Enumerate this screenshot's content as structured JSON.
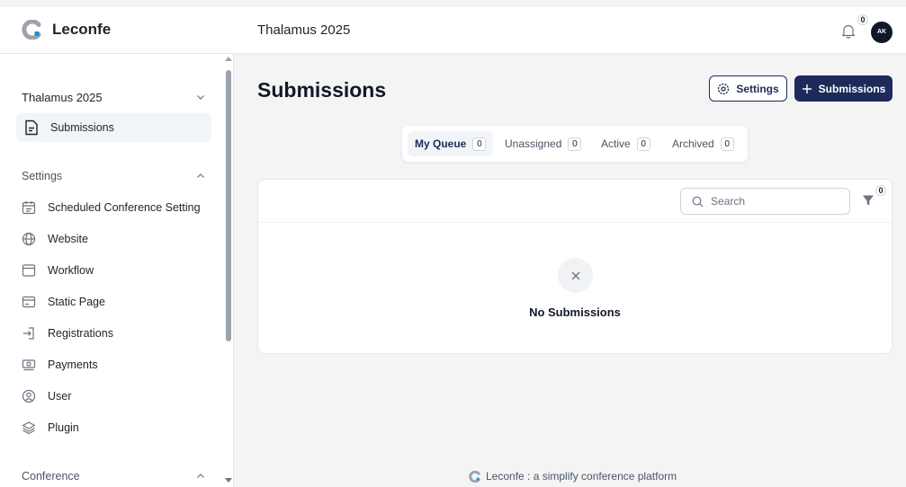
{
  "header": {
    "brand": "Leconfe",
    "conference": "Thalamus 2025",
    "notification_count": "0",
    "avatar_initials": "AK"
  },
  "sidebar": {
    "conference_select": "Thalamus 2025",
    "active_item": {
      "label": "Submissions",
      "icon": "document-icon"
    },
    "settings_group": {
      "label": "Settings",
      "items": [
        {
          "label": "Scheduled Conference Setting",
          "icon": "calendar-icon"
        },
        {
          "label": "Website",
          "icon": "globe-icon"
        },
        {
          "label": "Workflow",
          "icon": "window-icon"
        },
        {
          "label": "Static Page",
          "icon": "page-icon"
        },
        {
          "label": "Registrations",
          "icon": "login-icon"
        },
        {
          "label": "Payments",
          "icon": "cash-icon"
        },
        {
          "label": "User",
          "icon": "user-circle-icon"
        },
        {
          "label": "Plugin",
          "icon": "stack-icon"
        }
      ]
    },
    "conference_group": {
      "label": "Conference"
    }
  },
  "main": {
    "title": "Submissions",
    "settings_button": "Settings",
    "add_button": "Submissions",
    "tabs": [
      {
        "label": "My Queue",
        "count": "0"
      },
      {
        "label": "Unassigned",
        "count": "0"
      },
      {
        "label": "Active",
        "count": "0"
      },
      {
        "label": "Archived",
        "count": "0"
      }
    ],
    "search_placeholder": "Search",
    "filter_count": "0",
    "empty_message": "No Submissions"
  },
  "footer": {
    "text": "Leconfe : a simplify conference platform"
  },
  "colors": {
    "primary": "#1e2a5a",
    "background": "#f4f4f5",
    "surface": "#ffffff"
  }
}
